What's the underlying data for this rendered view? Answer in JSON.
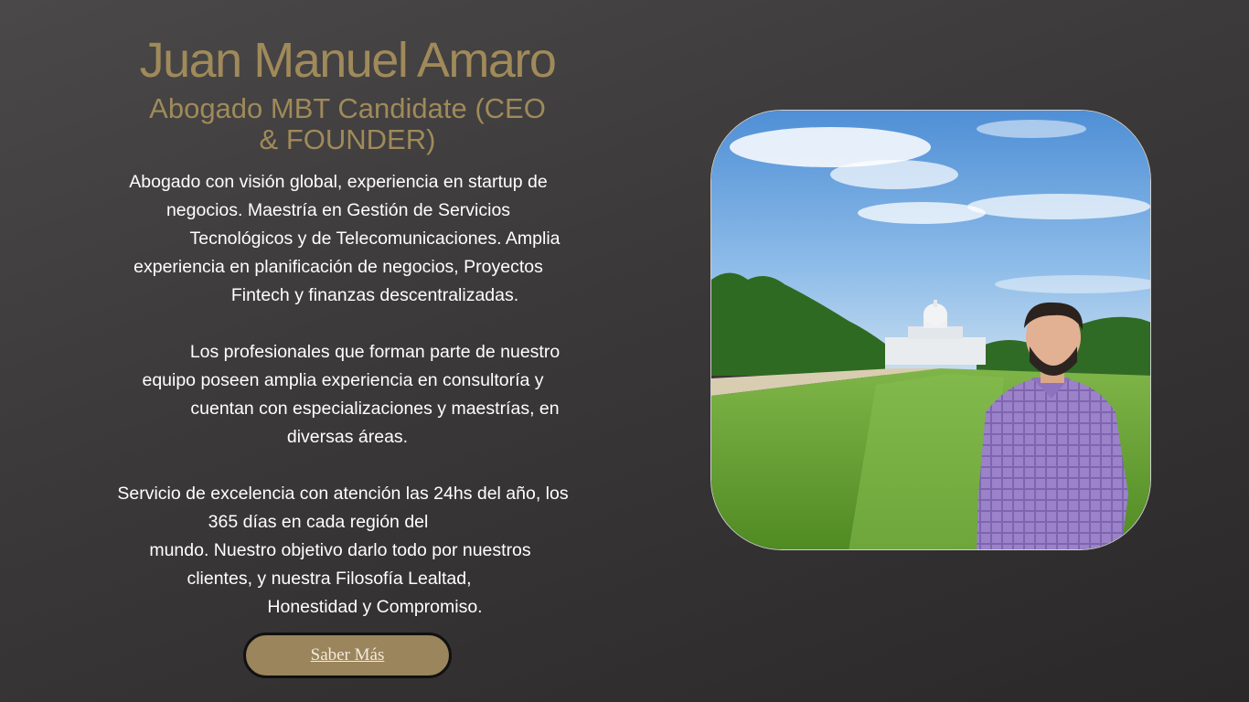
{
  "header": {
    "name": "Juan Manuel Amaro",
    "subtitle": "Abogado MBT Candidate (CEO & FOUNDER)"
  },
  "about": {
    "paragraph1": [
      "Abogado con visión global, experiencia en startup de",
      "negocios. Maestría en Gestión de Servicios",
      "Tecnológicos y de Telecomunicaciones. Amplia",
      "experiencia en planificación de negocios, Proyectos",
      "Fintech y finanzas descentralizadas."
    ],
    "paragraph2": [
      "Los profesionales que forman parte de nuestro",
      "equipo poseen amplia experiencia en consultoría y",
      "cuentan con especializaciones y maestrías, en",
      "diversas áreas."
    ],
    "paragraph3": [
      "Servicio de excelencia con atención las 24hs del año, los",
      "365 días en cada región del",
      "mundo. Nuestro objetivo darlo todo por nuestros",
      "clientes, y nuestra Filosofía Lealtad,",
      "Honestidad y Compromiso."
    ]
  },
  "cta": {
    "label": "Saber Más"
  },
  "colors": {
    "accent": "#a08a5a",
    "button_bg": "#9a855c",
    "background": "#3a3838",
    "text": "#ffffff"
  }
}
